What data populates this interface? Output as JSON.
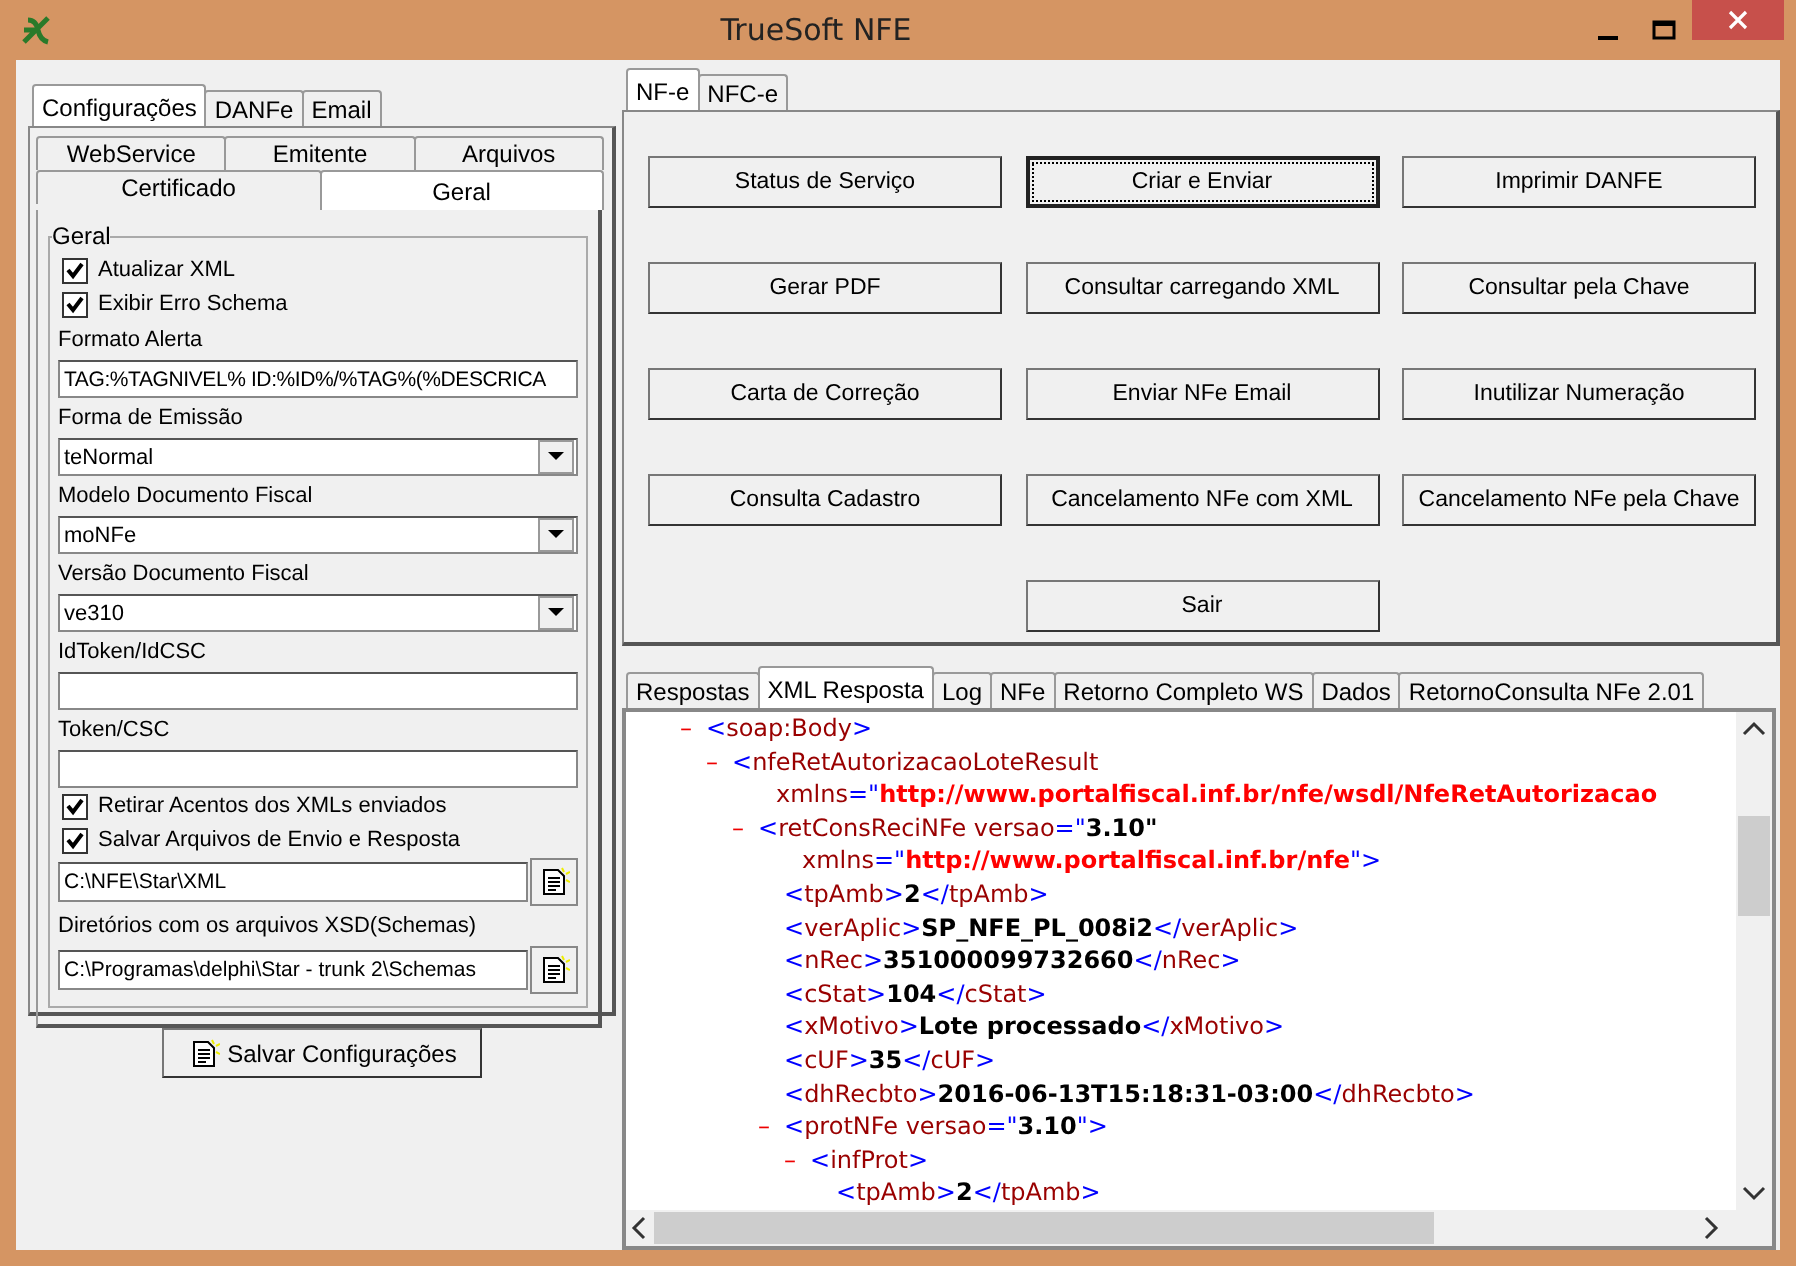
{
  "window": {
    "title": "TrueSoft NFE"
  },
  "left_tabs": [
    {
      "label": "Configurações",
      "selected": true
    },
    {
      "label": "DANFe",
      "selected": false
    },
    {
      "label": "Email",
      "selected": false
    }
  ],
  "config_tab_rows": [
    [
      {
        "label": "WebService",
        "selected": false
      },
      {
        "label": "Emitente",
        "selected": false
      },
      {
        "label": "Arquivos",
        "selected": false
      }
    ],
    [
      {
        "label": "Certificado",
        "selected": false
      },
      {
        "label": "Geral",
        "selected": true
      }
    ]
  ],
  "group": {
    "title": "Geral",
    "fields": [
      {
        "kind": "checkbox",
        "label": "Atualizar XML",
        "checked": true
      },
      {
        "kind": "checkbox",
        "label": "Exibir Erro Schema",
        "checked": true
      },
      {
        "kind": "label",
        "label": "Formato Alerta"
      },
      {
        "kind": "text",
        "value": "TAG:%TAGNIVEL% ID:%ID%/%TAG%(%DESCRICA"
      },
      {
        "kind": "label",
        "label": "Forma de Emissão"
      },
      {
        "kind": "combo",
        "value": "teNormal"
      },
      {
        "kind": "label",
        "label": "Modelo Documento Fiscal"
      },
      {
        "kind": "combo",
        "value": "moNFe"
      },
      {
        "kind": "label",
        "label": "Versão Documento Fiscal"
      },
      {
        "kind": "combo",
        "value": "ve310"
      },
      {
        "kind": "label",
        "label": "IdToken/IdCSC"
      },
      {
        "kind": "text"
      },
      {
        "kind": "label",
        "label": "Token/CSC"
      },
      {
        "kind": "text"
      },
      {
        "kind": "checkbox",
        "label": "Retirar Acentos dos XMLs enviados",
        "checked": true
      },
      {
        "kind": "checkbox",
        "label": "Salvar Arquivos de Envio e Resposta",
        "checked": true
      },
      {
        "kind": "path",
        "value": "C:\\NFE\\Star\\XML"
      },
      {
        "kind": "label",
        "label": "Diretórios com os arquivos XSD(Schemas)"
      },
      {
        "kind": "path",
        "value": "C:\\Programas\\delphi\\Star - trunk 2\\Schemas"
      }
    ]
  },
  "save_button": {
    "label": "Salvar Configurações"
  },
  "right_tabs": [
    {
      "label": "NF-e",
      "selected": true
    },
    {
      "label": "NFC-e",
      "selected": false
    }
  ],
  "actions": [
    {
      "label": "Status de Serviço",
      "focused": false
    },
    {
      "label": "Criar e Enviar",
      "focused": true
    },
    {
      "label": "Imprimir DANFE",
      "focused": false
    },
    {
      "label": "Gerar PDF",
      "focused": false
    },
    {
      "label": "Consultar carregando XML",
      "focused": false
    },
    {
      "label": "Consultar pela Chave",
      "focused": false
    },
    {
      "label": "Carta de Correção",
      "focused": false
    },
    {
      "label": "Enviar NFe Email",
      "focused": false
    },
    {
      "label": "Inutilizar Numeração",
      "focused": false
    },
    {
      "label": "Consulta Cadastro",
      "focused": false
    },
    {
      "label": "Cancelamento NFe com XML",
      "focused": false
    },
    {
      "label": "Cancelamento NFe pela Chave",
      "focused": false
    },
    {
      "label": "Sair",
      "focused": false
    }
  ],
  "result_tabs": [
    {
      "label": "Respostas",
      "selected": false
    },
    {
      "label": "XML Resposta",
      "selected": true
    },
    {
      "label": "Log",
      "selected": false
    },
    {
      "label": "NFe",
      "selected": false
    },
    {
      "label": "Retorno Completo WS",
      "selected": false
    },
    {
      "label": "Dados",
      "selected": false
    },
    {
      "label": "RetornoConsulta NFe 2.01",
      "selected": false
    }
  ],
  "xml": [
    {
      "toggle": "–",
      "lines": [
        [
          {
            "kind": "punct",
            "text": "<"
          },
          {
            "kind": "name",
            "text": "soap:Body"
          },
          {
            "kind": "punct",
            "text": ">"
          }
        ]
      ],
      "children": [
        {
          "toggle": "–",
          "lines": [
            [
              {
                "kind": "punct",
                "text": "<"
              },
              {
                "kind": "name",
                "text": "nfeRetAutorizacaoLoteResult"
              }
            ],
            [
              {
                "kind": "name",
                "text": "xmlns"
              },
              {
                "kind": "punct",
                "text": "=\""
              },
              {
                "kind": "url",
                "text": "http://www.portalfiscal.inf.br/nfe/wsdl/NfeRetAutorizacao"
              }
            ]
          ],
          "children": [
            {
              "toggle": "–",
              "lines": [
                [
                  {
                    "kind": "punct",
                    "text": "<"
                  },
                  {
                    "kind": "name",
                    "text": "retConsReciNFe versao"
                  },
                  {
                    "kind": "punct",
                    "text": "=\""
                  },
                  {
                    "kind": "value",
                    "text": "3.10\""
                  }
                ],
                [
                  {
                    "kind": "name",
                    "text": "xmlns"
                  },
                  {
                    "kind": "punct",
                    "text": "=\""
                  },
                  {
                    "kind": "url",
                    "text": "http://www.portalfiscal.inf.br/nfe"
                  },
                  {
                    "kind": "punct",
                    "text": "\">"
                  }
                ]
              ],
              "children": [
                {
                  "lines": [
                    [
                      {
                        "kind": "punct",
                        "text": "<"
                      },
                      {
                        "kind": "name",
                        "text": "tpAmb"
                      },
                      {
                        "kind": "punct",
                        "text": ">"
                      },
                      {
                        "kind": "value",
                        "text": "2"
                      },
                      {
                        "kind": "punct",
                        "text": "</"
                      },
                      {
                        "kind": "name",
                        "text": "tpAmb"
                      },
                      {
                        "kind": "punct",
                        "text": ">"
                      }
                    ]
                  ]
                },
                {
                  "lines": [
                    [
                      {
                        "kind": "punct",
                        "text": "<"
                      },
                      {
                        "kind": "name",
                        "text": "verAplic"
                      },
                      {
                        "kind": "punct",
                        "text": ">"
                      },
                      {
                        "kind": "value",
                        "text": "SP_NFE_PL_008i2"
                      },
                      {
                        "kind": "punct",
                        "text": "</"
                      },
                      {
                        "kind": "name",
                        "text": "verAplic"
                      },
                      {
                        "kind": "punct",
                        "text": ">"
                      }
                    ]
                  ]
                },
                {
                  "lines": [
                    [
                      {
                        "kind": "punct",
                        "text": "<"
                      },
                      {
                        "kind": "name",
                        "text": "nRec"
                      },
                      {
                        "kind": "punct",
                        "text": ">"
                      },
                      {
                        "kind": "value",
                        "text": "351000099732660"
                      },
                      {
                        "kind": "punct",
                        "text": "</"
                      },
                      {
                        "kind": "name",
                        "text": "nRec"
                      },
                      {
                        "kind": "punct",
                        "text": ">"
                      }
                    ]
                  ]
                },
                {
                  "lines": [
                    [
                      {
                        "kind": "punct",
                        "text": "<"
                      },
                      {
                        "kind": "name",
                        "text": "cStat"
                      },
                      {
                        "kind": "punct",
                        "text": ">"
                      },
                      {
                        "kind": "value",
                        "text": "104"
                      },
                      {
                        "kind": "punct",
                        "text": "</"
                      },
                      {
                        "kind": "name",
                        "text": "cStat"
                      },
                      {
                        "kind": "punct",
                        "text": ">"
                      }
                    ]
                  ]
                },
                {
                  "lines": [
                    [
                      {
                        "kind": "punct",
                        "text": "<"
                      },
                      {
                        "kind": "name",
                        "text": "xMotivo"
                      },
                      {
                        "kind": "punct",
                        "text": ">"
                      },
                      {
                        "kind": "value",
                        "text": "Lote processado"
                      },
                      {
                        "kind": "punct",
                        "text": "</"
                      },
                      {
                        "kind": "name",
                        "text": "xMotivo"
                      },
                      {
                        "kind": "punct",
                        "text": ">"
                      }
                    ]
                  ]
                },
                {
                  "lines": [
                    [
                      {
                        "kind": "punct",
                        "text": "<"
                      },
                      {
                        "kind": "name",
                        "text": "cUF"
                      },
                      {
                        "kind": "punct",
                        "text": ">"
                      },
                      {
                        "kind": "value",
                        "text": "35"
                      },
                      {
                        "kind": "punct",
                        "text": "</"
                      },
                      {
                        "kind": "name",
                        "text": "cUF"
                      },
                      {
                        "kind": "punct",
                        "text": ">"
                      }
                    ]
                  ]
                },
                {
                  "lines": [
                    [
                      {
                        "kind": "punct",
                        "text": "<"
                      },
                      {
                        "kind": "name",
                        "text": "dhRecbto"
                      },
                      {
                        "kind": "punct",
                        "text": ">"
                      },
                      {
                        "kind": "value",
                        "text": "2016-06-13T15:18:31-03:00"
                      },
                      {
                        "kind": "punct",
                        "text": "</"
                      },
                      {
                        "kind": "name",
                        "text": "dhRecbto"
                      },
                      {
                        "kind": "punct",
                        "text": ">"
                      }
                    ]
                  ]
                },
                {
                  "toggle": "–",
                  "lines": [
                    [
                      {
                        "kind": "punct",
                        "text": "<"
                      },
                      {
                        "kind": "name",
                        "text": "protNFe versao"
                      },
                      {
                        "kind": "punct",
                        "text": "=\""
                      },
                      {
                        "kind": "value",
                        "text": "3.10"
                      },
                      {
                        "kind": "punct",
                        "text": "\">"
                      }
                    ]
                  ],
                  "children": [
                    {
                      "toggle": "–",
                      "lines": [
                        [
                          {
                            "kind": "punct",
                            "text": "<"
                          },
                          {
                            "kind": "name",
                            "text": "infProt"
                          },
                          {
                            "kind": "punct",
                            "text": ">"
                          }
                        ]
                      ],
                      "children": [
                        {
                          "lines": [
                            [
                              {
                                "kind": "punct",
                                "text": "<"
                              },
                              {
                                "kind": "name",
                                "text": "tpAmb"
                              },
                              {
                                "kind": "punct",
                                "text": ">"
                              },
                              {
                                "kind": "value",
                                "text": "2"
                              },
                              {
                                "kind": "punct",
                                "text": "</"
                              },
                              {
                                "kind": "name",
                                "text": "tpAmb"
                              },
                              {
                                "kind": "punct",
                                "text": ">"
                              }
                            ]
                          ]
                        }
                      ]
                    }
                  ]
                }
              ]
            }
          ]
        }
      ]
    }
  ]
}
